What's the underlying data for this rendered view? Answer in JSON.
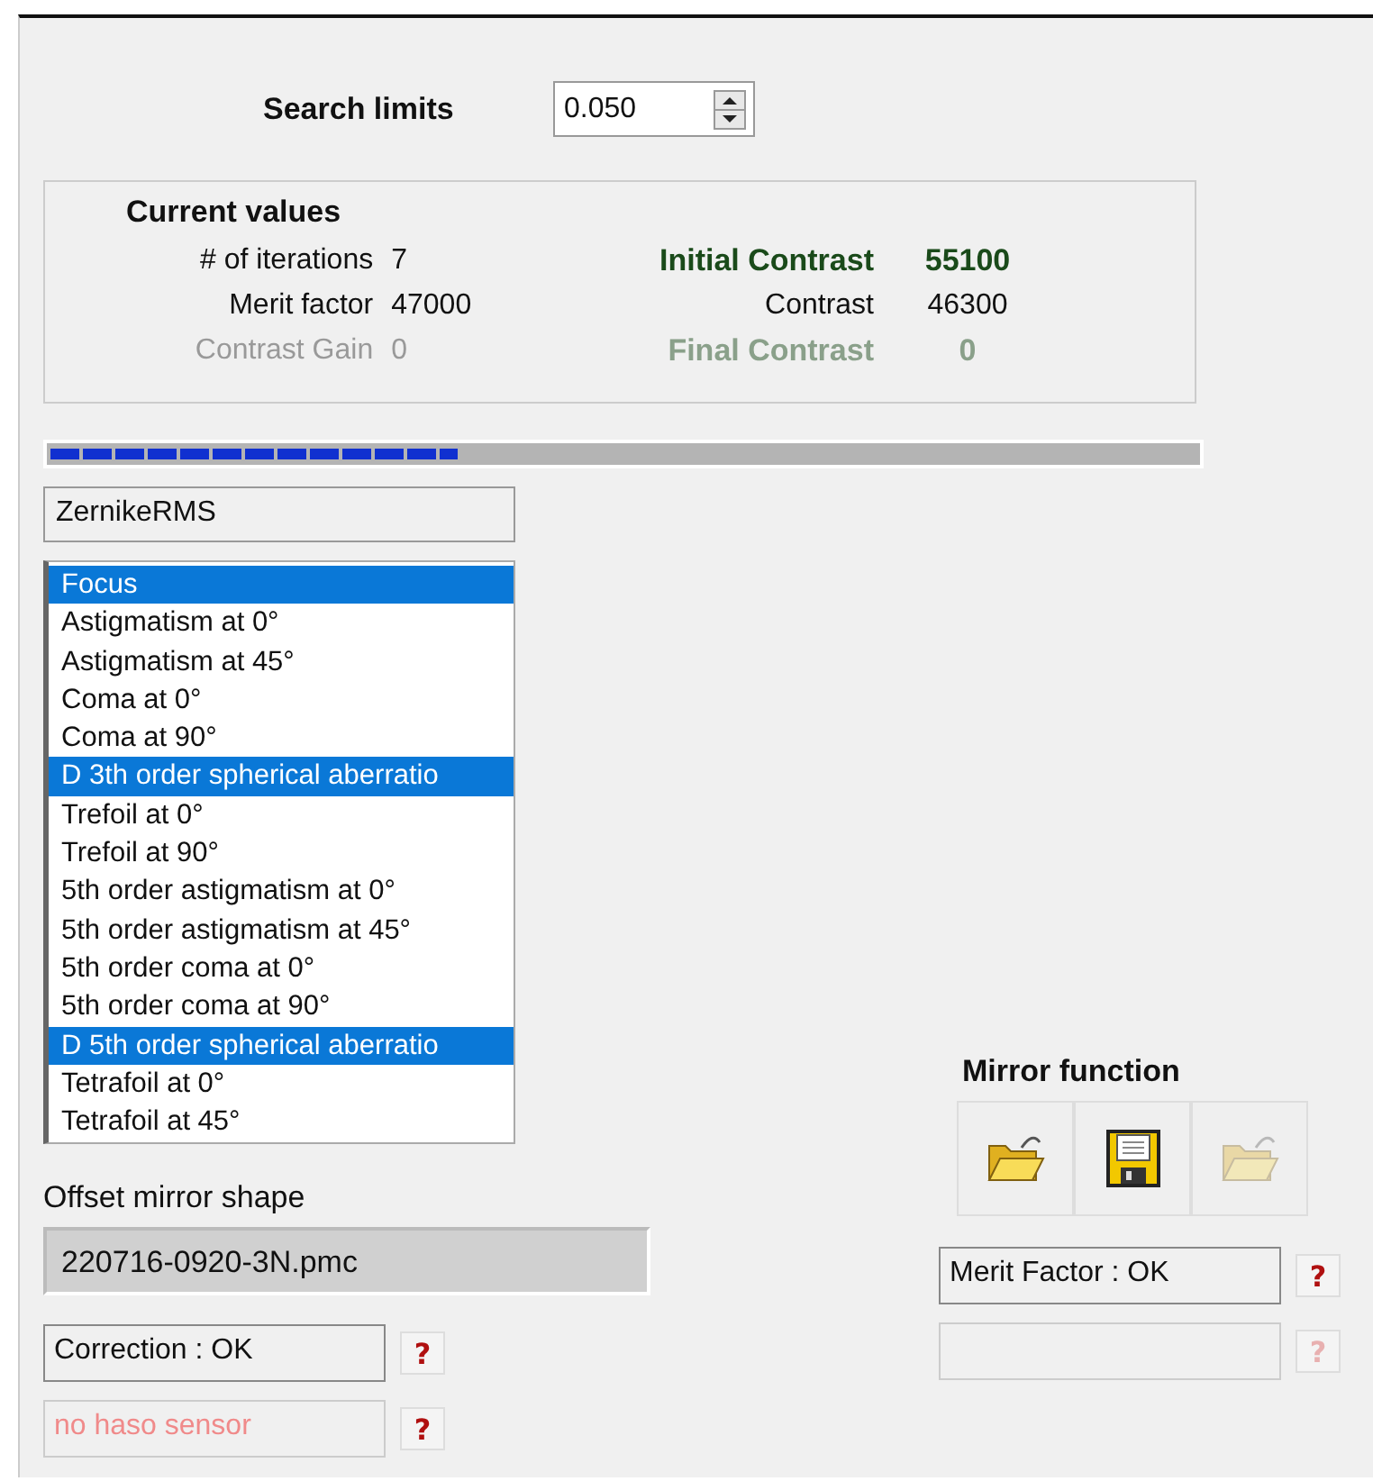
{
  "search_limits": {
    "label": "Search limits",
    "value": "0.050"
  },
  "current_values": {
    "title": "Current values",
    "left": [
      {
        "label": "# of iterations",
        "value": "7",
        "disabled": false
      },
      {
        "label": "Merit factor",
        "value": "47000",
        "disabled": false
      },
      {
        "label": "Contrast Gain",
        "value": "0",
        "disabled": true
      }
    ],
    "right": [
      {
        "label": "Initial Contrast",
        "value": "55100",
        "kind": "highlight",
        "disabled": false
      },
      {
        "label": "Contrast",
        "value": "46300",
        "kind": "normal",
        "disabled": false
      },
      {
        "label": "Final Contrast",
        "value": "0",
        "kind": "highlight",
        "disabled": true
      }
    ]
  },
  "progress": {
    "level": 0.355
  },
  "mode_field": {
    "value": "ZernikeRMS"
  },
  "modes": [
    {
      "label": "Focus",
      "selected": true
    },
    {
      "label": "Astigmatism at 0°",
      "selected": false
    },
    {
      "label": "Astigmatism at 45°",
      "selected": false
    },
    {
      "label": "Coma at 0°",
      "selected": false
    },
    {
      "label": "Coma at 90°",
      "selected": false
    },
    {
      "label": "D 3th order spherical aberratio",
      "selected": true
    },
    {
      "label": "Trefoil at 0°",
      "selected": false
    },
    {
      "label": "Trefoil at 90°",
      "selected": false
    },
    {
      "label": "5th order astigmatism at 0°",
      "selected": false
    },
    {
      "label": "5th order astigmatism at 45°",
      "selected": false
    },
    {
      "label": "5th order coma at 0°",
      "selected": false
    },
    {
      "label": "5th order coma at 90°",
      "selected": false
    },
    {
      "label": "D 5th order spherical aberratio",
      "selected": true
    },
    {
      "label": "Tetrafoil at 0°",
      "selected": false
    },
    {
      "label": "Tetrafoil at 45°",
      "selected": false
    }
  ],
  "offset_mirror": {
    "label": "Offset mirror shape",
    "value": "220716-0920-3N.pmc"
  },
  "mirror_function": {
    "title": "Mirror function",
    "buttons": [
      {
        "kind": "open",
        "disabled": false
      },
      {
        "kind": "save",
        "disabled": false
      },
      {
        "kind": "open",
        "disabled": true
      }
    ]
  },
  "status_left": [
    {
      "text": "Correction : OK",
      "kind": "ok",
      "help": "?",
      "help_disabled": false
    },
    {
      "text": "no haso sensor",
      "kind": "error",
      "help": "?",
      "help_disabled": false
    }
  ],
  "status_right": [
    {
      "text": "Merit Factor : OK",
      "kind": "ok",
      "help": "?",
      "help_disabled": false
    },
    {
      "kind": "empty",
      "help": "?",
      "help_disabled": true
    }
  ]
}
